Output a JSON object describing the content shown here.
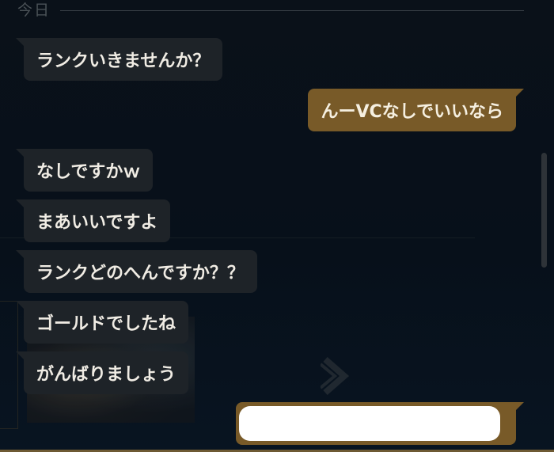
{
  "chat": {
    "date_divider": "今日",
    "messages": [
      {
        "side": "in",
        "text": "ランクいきませんか？"
      },
      {
        "side": "out",
        "text": "んーVCなしでいいなら"
      },
      {
        "side": "in",
        "text": "なしですかｗ"
      },
      {
        "side": "in",
        "text": "まあいいですよ"
      },
      {
        "side": "in",
        "text": "ランクどのへんですか？？"
      },
      {
        "side": "in",
        "text": "ゴールドでしたね"
      },
      {
        "side": "in",
        "text": "がんばりましょう"
      },
      {
        "side": "out",
        "text": ""
      }
    ]
  },
  "colors": {
    "background": "#08101a",
    "incoming_bubble": "#1e2328",
    "outgoing_bubble": "#785a28",
    "text": "#f0ece4",
    "accent_border": "#6e5a34"
  },
  "icons": {
    "background_chevron": "chevron-right-icon"
  }
}
